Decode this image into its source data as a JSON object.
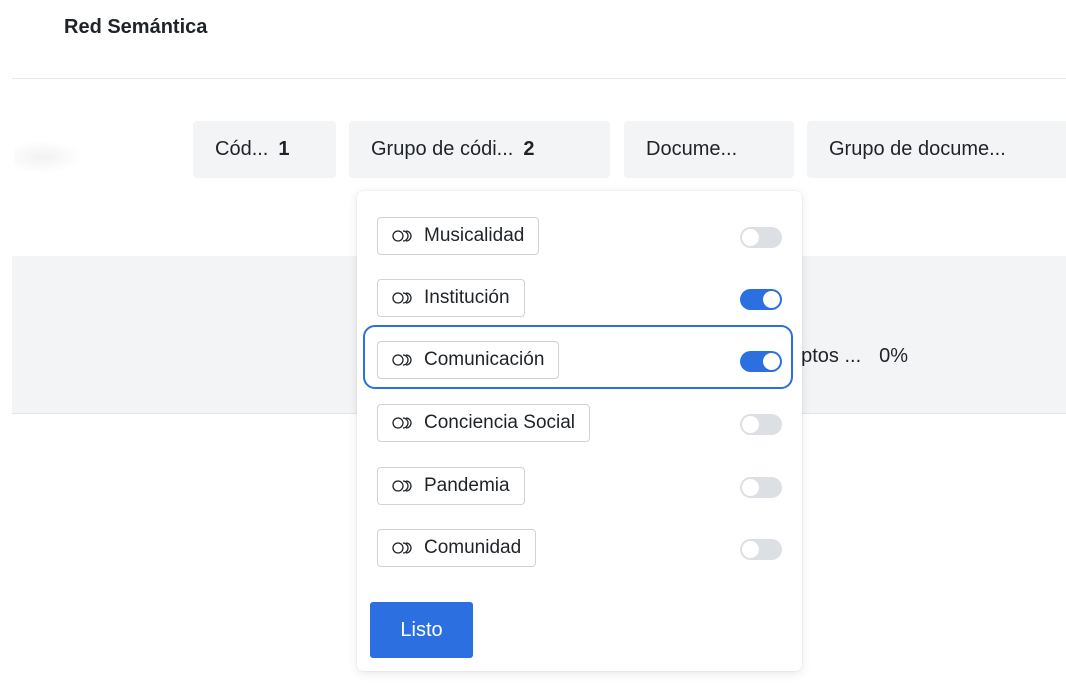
{
  "page": {
    "title": "Red Semántica"
  },
  "filters": [
    {
      "label": "Cód...",
      "count": "1"
    },
    {
      "label": "Grupo de códi...",
      "count": "2"
    },
    {
      "label": "Docume...",
      "count": ""
    },
    {
      "label": "Grupo de docume...",
      "count": ""
    }
  ],
  "table": {
    "row_text": "eptos ...",
    "row_pct": "0%"
  },
  "dropdown": {
    "options": [
      {
        "label": "Musicalidad",
        "enabled": false
      },
      {
        "label": "Institución",
        "enabled": true
      },
      {
        "label": "Comunicación",
        "enabled": true
      },
      {
        "label": "Conciencia Social",
        "enabled": false
      },
      {
        "label": "Pandemia",
        "enabled": false
      },
      {
        "label": "Comunidad",
        "enabled": false
      }
    ],
    "focused_option": "Comunicación",
    "done_label": "Listo"
  },
  "icons": {
    "option_icon": "code-group-icon",
    "toggle": "toggle-switch"
  },
  "colors": {
    "accent": "#2b6fe0",
    "toggle_off": "#dcdfe3",
    "chip_bg": "#f3f4f6"
  }
}
